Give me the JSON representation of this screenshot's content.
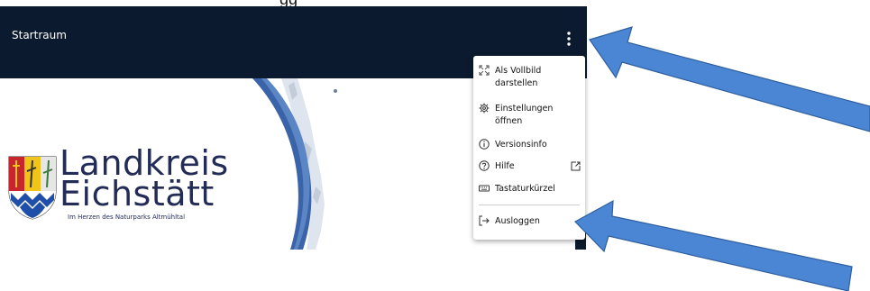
{
  "top_cut_text": "gg",
  "header": {
    "title": "Startraum"
  },
  "logo": {
    "line1": "Landkreis",
    "line2": "Eichstätt",
    "tagline": "Im Herzen des Naturparks Altmühltal"
  },
  "menu": {
    "items": [
      {
        "label": "Als Vollbild darstellen",
        "icon": "fullscreen-icon"
      },
      {
        "label": "Einstellungen öffnen",
        "icon": "gear-icon"
      },
      {
        "label": "Versionsinfo",
        "icon": "info-icon"
      },
      {
        "label": "Hilfe",
        "icon": "help-icon",
        "trailing_icon": "external-link-icon"
      },
      {
        "label": "Tastaturkürzel",
        "icon": "keyboard-icon"
      },
      {
        "label": "Ausloggen",
        "icon": "logout-icon"
      }
    ]
  },
  "colors": {
    "header_bg": "#0b1a2e",
    "logo_text": "#222c57",
    "annotation_arrow": "#4a86d4"
  }
}
